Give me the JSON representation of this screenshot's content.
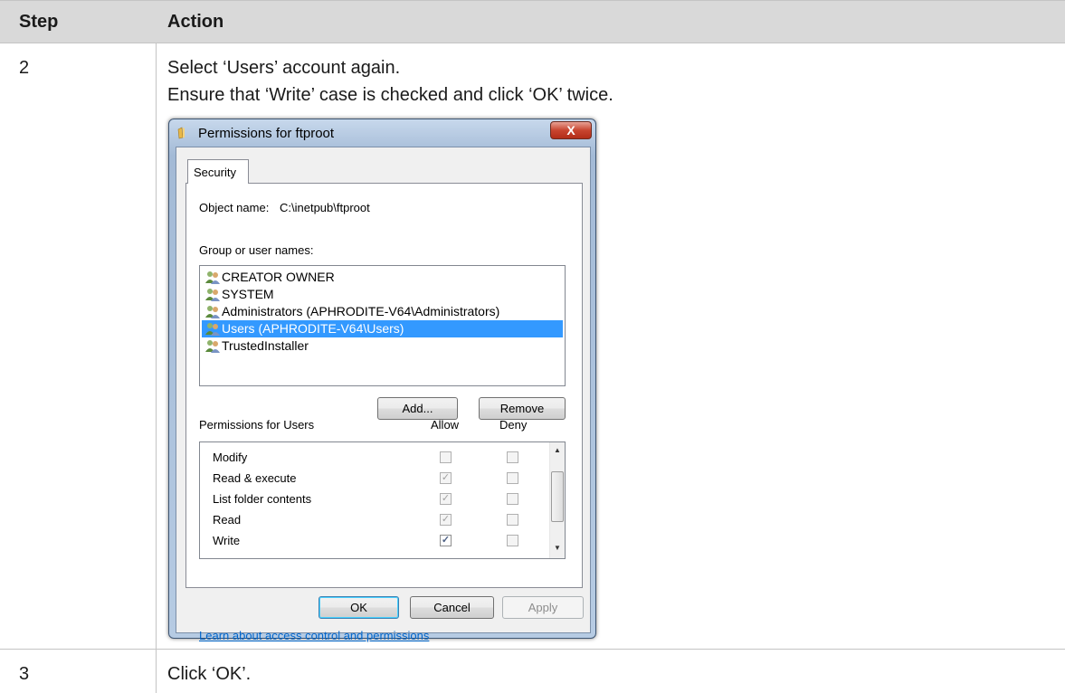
{
  "table": {
    "headers": {
      "step": "Step",
      "action": "Action"
    },
    "rows": [
      {
        "step": "2",
        "line1": "Select ‘Users’ account again.",
        "line2": "Ensure that ‘Write’ case is checked and click ‘OK’ twice."
      },
      {
        "step": "3",
        "line1": "Click ‘OK’."
      }
    ]
  },
  "dialog": {
    "title": "Permissions for ftproot",
    "close_label": "X",
    "tab_label": "Security",
    "object_name_label": "Object name:",
    "object_name_value": "C:\\inetpub\\ftproot",
    "group_label": "Group or user names:",
    "users": [
      "CREATOR OWNER",
      "SYSTEM",
      "Administrators (APHRODITE-V64\\Administrators)",
      "Users (APHRODITE-V64\\Users)",
      "TrustedInstaller"
    ],
    "selected_user_index": 3,
    "add_label": "Add...",
    "remove_label": "Remove",
    "permissions_label": "Permissions for Users",
    "allow_label": "Allow",
    "deny_label": "Deny",
    "permissions": [
      {
        "name": "Modify",
        "allow": false,
        "deny": false,
        "allow_inherited": false
      },
      {
        "name": "Read & execute",
        "allow": true,
        "deny": false,
        "allow_inherited": true
      },
      {
        "name": "List folder contents",
        "allow": true,
        "deny": false,
        "allow_inherited": true
      },
      {
        "name": "Read",
        "allow": true,
        "deny": false,
        "allow_inherited": true
      },
      {
        "name": "Write",
        "allow": true,
        "deny": false,
        "allow_inherited": false
      }
    ],
    "link_text": "Learn about access control and permissions",
    "ok_label": "OK",
    "cancel_label": "Cancel",
    "apply_label": "Apply"
  },
  "colors": {
    "header_bg": "#d9d9d9",
    "selection": "#3399ff",
    "link": "#0066cc"
  }
}
